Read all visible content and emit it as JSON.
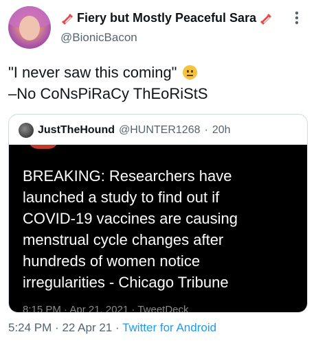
{
  "author": {
    "display_name": "Fiery but Mostly Peaceful Sara",
    "handle": "@BionicBacon",
    "name_emoji": "ribbon-icon"
  },
  "tweet": {
    "line1": "\"I never saw this coming\"",
    "line1_emoji": "neutral-face-emoji",
    "line2": "–No CoNsPiRaCy ThEoRiStS"
  },
  "quoted": {
    "display_name": "JustTheHound",
    "handle": "@HUNTER1268",
    "separator": "·",
    "age": "20h",
    "image_lines": [
      "BREAKING: Researchers have",
      "launched a study to find out if",
      "COVID-19 vaccines are causing",
      "menstrual cycle changes after",
      "hundreds of women notice",
      "irregularities - Chicago Tribune"
    ],
    "image_footer": "8:15 PM · Apr 21, 2021 · TweetDeck"
  },
  "meta": {
    "time": "5:24 PM",
    "date": "22 Apr 21",
    "separator": "·",
    "source": "Twitter for Android"
  },
  "colors": {
    "link": "#1d9bf0",
    "secondary_text": "#536471",
    "image_bg": "#000000"
  }
}
